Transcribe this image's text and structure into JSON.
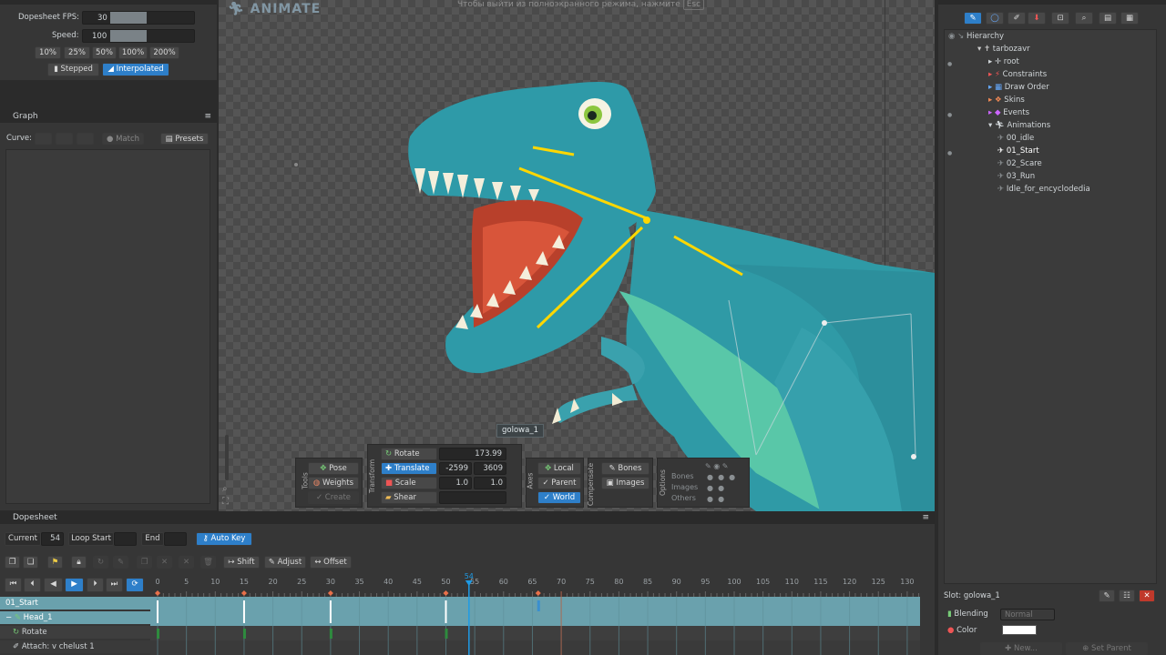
{
  "playback": {
    "fps_label": "Dopesheet FPS:",
    "fps": "30",
    "fps_level": 0.5,
    "speed_label": "Speed:",
    "speed": "100",
    "speed_level": 0.5,
    "speeds": [
      "10%",
      "25%",
      "50%",
      "100%",
      "200%"
    ],
    "stepped": "Stepped",
    "interpolated": "Interpolated"
  },
  "graph": {
    "title": "Graph",
    "curve": "Curve:",
    "match": "Match",
    "presets": "Presets"
  },
  "viewport": {
    "mode": "ANIMATE",
    "notice": "Чтобы выйти из полноэкранного режима, нажмите",
    "notice_key": "Esc",
    "bone_label": "golowa_1"
  },
  "tools": {
    "group": "Tools",
    "pose": "Pose",
    "weights": "Weights",
    "create": "Create"
  },
  "transform": {
    "group": "Transform",
    "rotate": "Rotate",
    "rotate_val": "173.99",
    "translate": "Translate",
    "tx": "-2599",
    "ty": "3609",
    "scale": "Scale",
    "sx": "1.0",
    "sy": "1.0",
    "shear": "Shear"
  },
  "axes": {
    "group": "Axes",
    "local": "Local",
    "parent": "Parent",
    "world": "World"
  },
  "compensate": {
    "group": "Compensate",
    "bones": "Bones",
    "images": "Images"
  },
  "options": {
    "group": "Options",
    "bones": "Bones",
    "images": "Images",
    "others": "Others"
  },
  "tree": {
    "title": "Hierarchy",
    "root_skel": "tarbozavr",
    "items": [
      "root",
      "Constraints",
      "Draw Order",
      "Skins",
      "Events",
      "Animations"
    ],
    "animations": [
      "00_idle",
      "01_Start",
      "02_Scare",
      "03_Run",
      "Idle_for_encyclodedia"
    ]
  },
  "slot": {
    "title": "Slot: golowa_1",
    "blending": "Blending",
    "blend_val": "Normal",
    "color": "Color",
    "color_swatch": "#ffffff",
    "new": "New...",
    "set_parent": "Set Parent"
  },
  "dopesheet": {
    "title": "Dopesheet",
    "current": "Current",
    "current_val": "54",
    "loop_start": "Loop Start",
    "end": "End",
    "auto_key": "Auto Key",
    "shift": "Shift",
    "adjust": "Adjust",
    "offset": "Offset",
    "ticks": [
      "0",
      "5",
      "10",
      "15",
      "20",
      "25",
      "30",
      "35",
      "40",
      "45",
      "50",
      "55",
      "60",
      "65",
      "70",
      "75",
      "80",
      "85",
      "90",
      "95",
      "100",
      "105",
      "110",
      "115",
      "120",
      "125",
      "130"
    ],
    "playhead": "54",
    "rows": [
      "01_Start",
      "Head_1",
      "Rotate",
      "Attach: v chelust 1"
    ],
    "keys": [
      0,
      15,
      30,
      50
    ],
    "row3_keys": [
      0,
      15,
      30,
      50
    ]
  }
}
